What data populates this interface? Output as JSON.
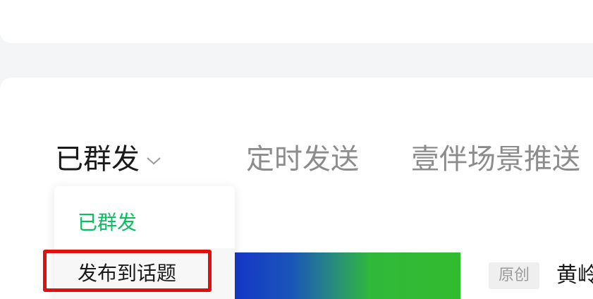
{
  "tabs": {
    "sent": "已群发",
    "scheduled": "定时发送",
    "companion_push": "壹伴场景推送"
  },
  "dropdown": {
    "items": [
      {
        "label": "已群发",
        "selected": true
      },
      {
        "label": "发布到话题",
        "selected": false
      }
    ]
  },
  "article": {
    "badge": "原创",
    "title_partial": "黄岭"
  },
  "colors": {
    "accent_green": "#07c160",
    "highlight_red": "#e0100e",
    "inactive_tab": "#8c8c8c"
  },
  "icons": {
    "tab_dropdown": "chevron-down-icon"
  }
}
